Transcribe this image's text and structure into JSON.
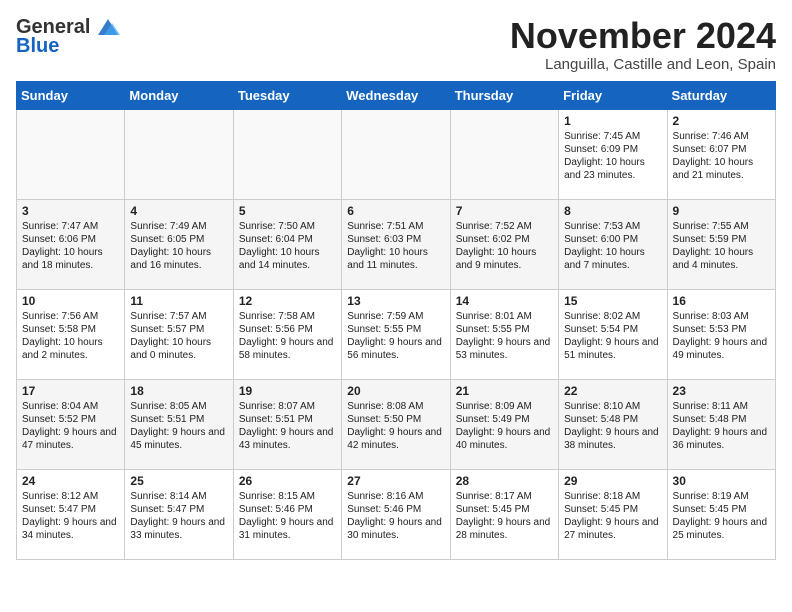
{
  "header": {
    "logo_line1": "General",
    "logo_line2": "Blue",
    "month_title": "November 2024",
    "location": "Languilla, Castille and Leon, Spain"
  },
  "weekdays": [
    "Sunday",
    "Monday",
    "Tuesday",
    "Wednesday",
    "Thursday",
    "Friday",
    "Saturday"
  ],
  "weeks": [
    [
      {
        "day": "",
        "info": ""
      },
      {
        "day": "",
        "info": ""
      },
      {
        "day": "",
        "info": ""
      },
      {
        "day": "",
        "info": ""
      },
      {
        "day": "",
        "info": ""
      },
      {
        "day": "1",
        "info": "Sunrise: 7:45 AM\nSunset: 6:09 PM\nDaylight: 10 hours and 23 minutes."
      },
      {
        "day": "2",
        "info": "Sunrise: 7:46 AM\nSunset: 6:07 PM\nDaylight: 10 hours and 21 minutes."
      }
    ],
    [
      {
        "day": "3",
        "info": "Sunrise: 7:47 AM\nSunset: 6:06 PM\nDaylight: 10 hours and 18 minutes."
      },
      {
        "day": "4",
        "info": "Sunrise: 7:49 AM\nSunset: 6:05 PM\nDaylight: 10 hours and 16 minutes."
      },
      {
        "day": "5",
        "info": "Sunrise: 7:50 AM\nSunset: 6:04 PM\nDaylight: 10 hours and 14 minutes."
      },
      {
        "day": "6",
        "info": "Sunrise: 7:51 AM\nSunset: 6:03 PM\nDaylight: 10 hours and 11 minutes."
      },
      {
        "day": "7",
        "info": "Sunrise: 7:52 AM\nSunset: 6:02 PM\nDaylight: 10 hours and 9 minutes."
      },
      {
        "day": "8",
        "info": "Sunrise: 7:53 AM\nSunset: 6:00 PM\nDaylight: 10 hours and 7 minutes."
      },
      {
        "day": "9",
        "info": "Sunrise: 7:55 AM\nSunset: 5:59 PM\nDaylight: 10 hours and 4 minutes."
      }
    ],
    [
      {
        "day": "10",
        "info": "Sunrise: 7:56 AM\nSunset: 5:58 PM\nDaylight: 10 hours and 2 minutes."
      },
      {
        "day": "11",
        "info": "Sunrise: 7:57 AM\nSunset: 5:57 PM\nDaylight: 10 hours and 0 minutes."
      },
      {
        "day": "12",
        "info": "Sunrise: 7:58 AM\nSunset: 5:56 PM\nDaylight: 9 hours and 58 minutes."
      },
      {
        "day": "13",
        "info": "Sunrise: 7:59 AM\nSunset: 5:55 PM\nDaylight: 9 hours and 56 minutes."
      },
      {
        "day": "14",
        "info": "Sunrise: 8:01 AM\nSunset: 5:55 PM\nDaylight: 9 hours and 53 minutes."
      },
      {
        "day": "15",
        "info": "Sunrise: 8:02 AM\nSunset: 5:54 PM\nDaylight: 9 hours and 51 minutes."
      },
      {
        "day": "16",
        "info": "Sunrise: 8:03 AM\nSunset: 5:53 PM\nDaylight: 9 hours and 49 minutes."
      }
    ],
    [
      {
        "day": "17",
        "info": "Sunrise: 8:04 AM\nSunset: 5:52 PM\nDaylight: 9 hours and 47 minutes."
      },
      {
        "day": "18",
        "info": "Sunrise: 8:05 AM\nSunset: 5:51 PM\nDaylight: 9 hours and 45 minutes."
      },
      {
        "day": "19",
        "info": "Sunrise: 8:07 AM\nSunset: 5:51 PM\nDaylight: 9 hours and 43 minutes."
      },
      {
        "day": "20",
        "info": "Sunrise: 8:08 AM\nSunset: 5:50 PM\nDaylight: 9 hours and 42 minutes."
      },
      {
        "day": "21",
        "info": "Sunrise: 8:09 AM\nSunset: 5:49 PM\nDaylight: 9 hours and 40 minutes."
      },
      {
        "day": "22",
        "info": "Sunrise: 8:10 AM\nSunset: 5:48 PM\nDaylight: 9 hours and 38 minutes."
      },
      {
        "day": "23",
        "info": "Sunrise: 8:11 AM\nSunset: 5:48 PM\nDaylight: 9 hours and 36 minutes."
      }
    ],
    [
      {
        "day": "24",
        "info": "Sunrise: 8:12 AM\nSunset: 5:47 PM\nDaylight: 9 hours and 34 minutes."
      },
      {
        "day": "25",
        "info": "Sunrise: 8:14 AM\nSunset: 5:47 PM\nDaylight: 9 hours and 33 minutes."
      },
      {
        "day": "26",
        "info": "Sunrise: 8:15 AM\nSunset: 5:46 PM\nDaylight: 9 hours and 31 minutes."
      },
      {
        "day": "27",
        "info": "Sunrise: 8:16 AM\nSunset: 5:46 PM\nDaylight: 9 hours and 30 minutes."
      },
      {
        "day": "28",
        "info": "Sunrise: 8:17 AM\nSunset: 5:45 PM\nDaylight: 9 hours and 28 minutes."
      },
      {
        "day": "29",
        "info": "Sunrise: 8:18 AM\nSunset: 5:45 PM\nDaylight: 9 hours and 27 minutes."
      },
      {
        "day": "30",
        "info": "Sunrise: 8:19 AM\nSunset: 5:45 PM\nDaylight: 9 hours and 25 minutes."
      }
    ]
  ]
}
